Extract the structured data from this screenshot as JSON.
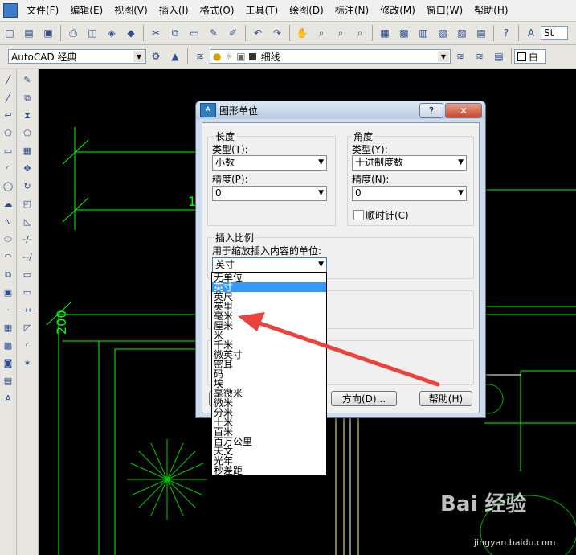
{
  "menubar": {
    "items": [
      "文件(F)",
      "编辑(E)",
      "视图(V)",
      "插入(I)",
      "格式(O)",
      "工具(T)",
      "绘图(D)",
      "标注(N)",
      "修改(M)",
      "窗口(W)",
      "帮助(H)"
    ]
  },
  "toolbar": {
    "workspace": "AutoCAD 经典",
    "linetype": "细线",
    "color": "白",
    "text_style": "St"
  },
  "dialog": {
    "title": "图形单位",
    "help_glyph": "?",
    "close_glyph": "✕",
    "length": {
      "group": "长度",
      "type_label": "类型(T):",
      "type_value": "小数",
      "precision_label": "精度(P):",
      "precision_value": "0"
    },
    "angle": {
      "group": "角度",
      "type_label": "类型(Y):",
      "type_value": "十进制度数",
      "precision_label": "精度(N):",
      "precision_value": "0",
      "clockwise_label": "顺时针(C)"
    },
    "insert_scale": {
      "group": "插入比例",
      "units_label": "用于缩放插入内容的单位:",
      "units_value": "英寸"
    },
    "buttons": {
      "direction": "方向(D)...",
      "help": "帮助(H)"
    },
    "unit_options": [
      "无单位",
      "英寸",
      "英尺",
      "英里",
      "毫米",
      "厘米",
      "米",
      "千米",
      "微英寸",
      "密耳",
      "码",
      "埃",
      "毫微米",
      "微米",
      "分米",
      "十米",
      "百米",
      "百万公里",
      "天文",
      "光年",
      "秒差距"
    ],
    "selected_option": "英寸"
  },
  "canvas": {
    "dimension_text": "200",
    "dimension_text_2": "1"
  },
  "watermark": {
    "brand": "Bai 经验",
    "url": "jingyan.baidu.com"
  },
  "colors": {
    "canvas_bg": "#000000",
    "cad_green": "#00ff00",
    "arrow_red": "#e8433e",
    "selection_blue": "#3399ff"
  }
}
